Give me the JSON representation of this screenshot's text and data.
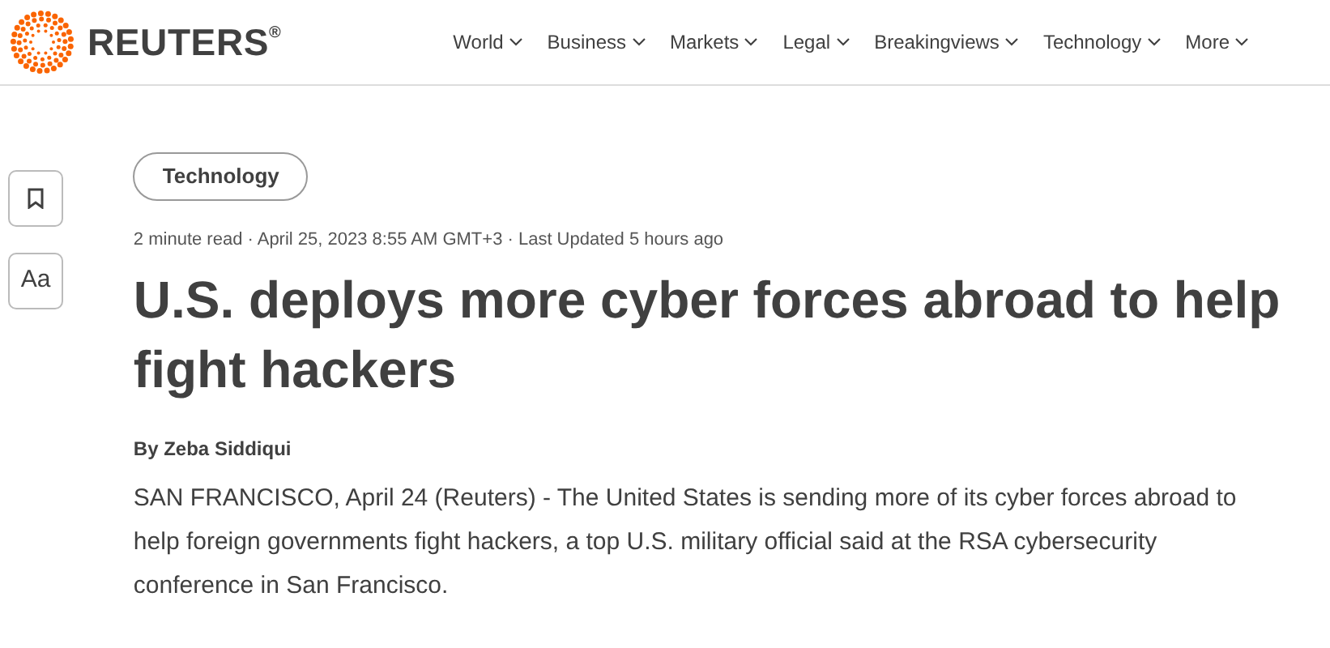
{
  "header": {
    "brand": "REUTERS",
    "registered": "®",
    "nav": [
      {
        "label": "World"
      },
      {
        "label": "Business"
      },
      {
        "label": "Markets"
      },
      {
        "label": "Legal"
      },
      {
        "label": "Breakingviews"
      },
      {
        "label": "Technology"
      },
      {
        "label": "More"
      }
    ]
  },
  "tools": [
    {
      "kind": "bookmark"
    },
    {
      "kind": "text",
      "label": "Aa"
    }
  ],
  "article": {
    "tag": "Technology",
    "meta": "2 minute read · April 25, 2023 8:55 AM GMT+3 · Last Updated 5 hours ago",
    "headline": "U.S. deploys more cyber forces abroad to help fight hackers",
    "byline": "By Zeba Siddiqui",
    "body": "SAN FRANCISCO, April 24 (Reuters) - The United States is sending more of its cyber forces abroad to help foreign governments fight hackers, a top U.S. military official said at the RSA cybersecurity conference in San Francisco."
  }
}
